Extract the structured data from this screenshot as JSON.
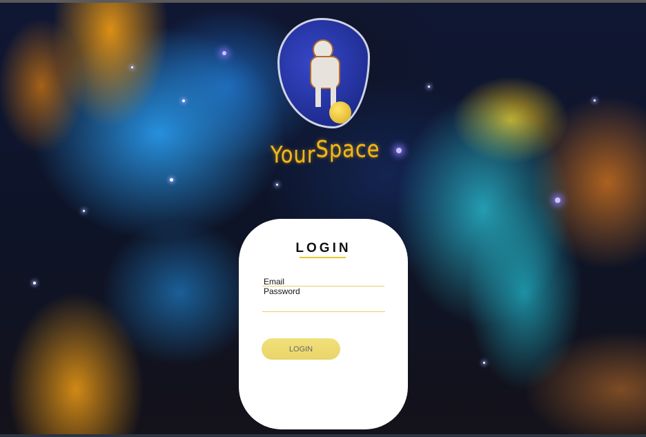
{
  "brand": {
    "word_left": "Your",
    "word_right": "Space",
    "logo_icon": "astronaut-on-ball-icon"
  },
  "login_card": {
    "title": "LOGIN",
    "email_label": "Email",
    "password_label": "Password",
    "submit_label": "LOGIN"
  },
  "colors": {
    "accent_yellow": "#e7c829",
    "button_fill": "#ecd86f",
    "card_bg": "#ffffff",
    "brand_text": "#f0b81e"
  },
  "background": {
    "description_icon": "nebula-background"
  }
}
